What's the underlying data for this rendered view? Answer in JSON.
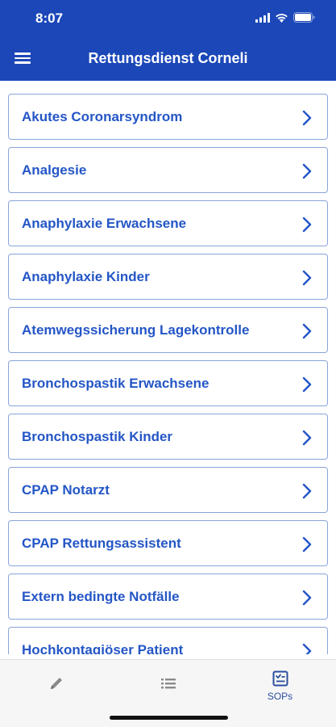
{
  "status_bar": {
    "time": "8:07"
  },
  "header": {
    "title": "Rettungsdienst Corneli",
    "menu_icon": "hamburger-menu-icon"
  },
  "colors": {
    "brand": "#1b47b8",
    "item_text": "#2456c6",
    "item_border": "#8aa3dc"
  },
  "sop_list": {
    "items": [
      {
        "label": "Akutes Coronarsyndrom"
      },
      {
        "label": "Analgesie"
      },
      {
        "label": "Anaphylaxie Erwachsene"
      },
      {
        "label": "Anaphylaxie Kinder"
      },
      {
        "label": "Atemwegssicherung Lagekontrolle"
      },
      {
        "label": "Bronchospastik Erwachsene"
      },
      {
        "label": "Bronchospastik Kinder"
      },
      {
        "label": "CPAP Notarzt"
      },
      {
        "label": "CPAP Rettungsassistent"
      },
      {
        "label": "Extern bedingte Notfälle"
      },
      {
        "label": "Hochkontagiöser Patient"
      }
    ]
  },
  "tab_bar": {
    "tabs": [
      {
        "icon": "pencil-icon",
        "label": ""
      },
      {
        "icon": "list-icon",
        "label": ""
      },
      {
        "icon": "checklist-icon",
        "label": "SOPs",
        "active": true
      }
    ]
  }
}
